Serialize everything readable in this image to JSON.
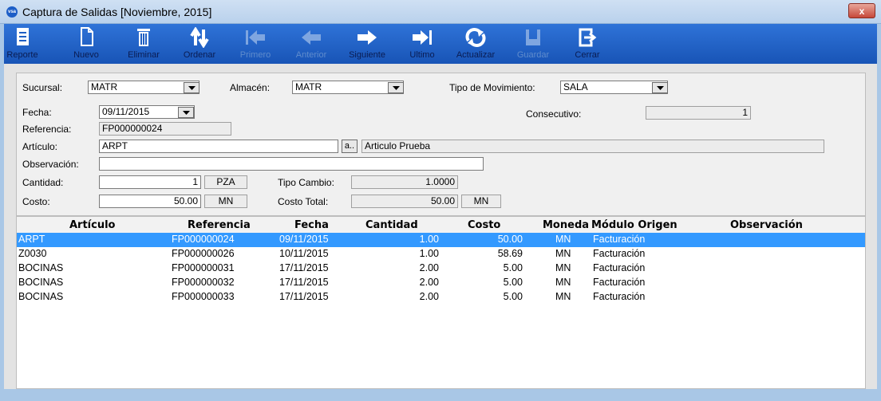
{
  "window": {
    "title": "Captura de Salidas  [Noviembre, 2015]",
    "app_icon_text": "vsa",
    "close_label": "x"
  },
  "toolbar": {
    "buttons": [
      {
        "label": "Reporte",
        "icon": "report-icon",
        "enabled": true
      },
      {
        "label": "Nuevo",
        "icon": "new-document-icon",
        "enabled": true
      },
      {
        "label": "Eliminar",
        "icon": "trash-icon",
        "enabled": true
      },
      {
        "label": "Ordenar",
        "icon": "sort-icon",
        "enabled": true
      },
      {
        "label": "Primero",
        "icon": "first-arrow-icon",
        "enabled": false
      },
      {
        "label": "Anterior",
        "icon": "previous-arrow-icon",
        "enabled": false
      },
      {
        "label": "Siguiente",
        "icon": "next-arrow-icon",
        "enabled": true
      },
      {
        "label": "Ultimo",
        "icon": "last-arrow-icon",
        "enabled": true
      },
      {
        "label": "Actualizar",
        "icon": "refresh-icon",
        "enabled": true
      },
      {
        "label": "Guardar",
        "icon": "save-icon",
        "enabled": false
      },
      {
        "label": "Cerrar",
        "icon": "exit-icon",
        "enabled": true
      }
    ]
  },
  "form": {
    "sucursal": {
      "label": "Sucursal:",
      "value": "MATR"
    },
    "almacen": {
      "label": "Almacén:",
      "value": "MATR"
    },
    "tipo_movimiento": {
      "label": "Tipo de Movimiento:",
      "value": "SALA"
    },
    "fecha": {
      "label": "Fecha:",
      "value": "09/11/2015"
    },
    "consecutivo": {
      "label": "Consecutivo:",
      "value": "1"
    },
    "referencia": {
      "label": "Referencia:",
      "value": "FP000000024"
    },
    "articulo": {
      "label": "Artículo:",
      "value": "ARPT",
      "lookup_label": "a..",
      "description": "Articulo Prueba"
    },
    "observacion": {
      "label": "Observación:",
      "value": ""
    },
    "cantidad": {
      "label": "Cantidad:",
      "value": "1",
      "unit": "PZA"
    },
    "tipo_cambio": {
      "label": "Tipo Cambio:",
      "value": "1.0000"
    },
    "costo": {
      "label": "Costo:",
      "value": "50.00",
      "currency": "MN"
    },
    "costo_total": {
      "label": "Costo Total:",
      "value": "50.00",
      "currency": "MN"
    }
  },
  "grid": {
    "columns": [
      "Artículo",
      "Referencia",
      "Fecha",
      "Cantidad",
      "Costo",
      "Moneda",
      "Módulo Origen",
      "Observación"
    ],
    "rows": [
      {
        "articulo": "ARPT",
        "referencia": "FP000000024",
        "fecha": "09/11/2015",
        "cantidad": "1.00",
        "costo": "50.00",
        "moneda": "MN",
        "modulo": "Facturación",
        "observacion": "",
        "selected": true
      },
      {
        "articulo": "Z0030",
        "referencia": "FP000000026",
        "fecha": "10/11/2015",
        "cantidad": "1.00",
        "costo": "58.69",
        "moneda": "MN",
        "modulo": "Facturación",
        "observacion": "",
        "selected": false
      },
      {
        "articulo": "BOCINAS",
        "referencia": "FP000000031",
        "fecha": "17/11/2015",
        "cantidad": "2.00",
        "costo": "5.00",
        "moneda": "MN",
        "modulo": "Facturación",
        "observacion": "",
        "selected": false
      },
      {
        "articulo": "BOCINAS",
        "referencia": "FP000000032",
        "fecha": "17/11/2015",
        "cantidad": "2.00",
        "costo": "5.00",
        "moneda": "MN",
        "modulo": "Facturación",
        "observacion": "",
        "selected": false
      },
      {
        "articulo": "BOCINAS",
        "referencia": "FP000000033",
        "fecha": "17/11/2015",
        "cantidad": "2.00",
        "costo": "5.00",
        "moneda": "MN",
        "modulo": "Facturación",
        "observacion": "",
        "selected": false
      }
    ]
  },
  "colors": {
    "toolbar": "#1f5fc4",
    "selection": "#3399ff",
    "window_frame": "#a9c7e6"
  }
}
